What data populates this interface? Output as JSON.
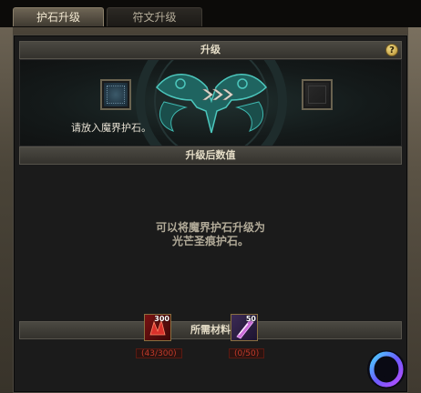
{
  "tabs": [
    {
      "label": "护石升级",
      "active": true
    },
    {
      "label": "符文升级",
      "active": false
    }
  ],
  "upgrade_section": {
    "title": "升级",
    "help_label": "?",
    "slot_hint": "请放入魔界护石。"
  },
  "result_section": {
    "title": "升级后数值",
    "line1": "可以将魔界护石升级为",
    "line2": "光芒圣痕护石。"
  },
  "materials_section": {
    "title": "所需材料",
    "items": [
      {
        "stack": "300",
        "count": "(43/300)",
        "icon": "red-material-icon"
      },
      {
        "stack": "50",
        "count": "(0/50)",
        "icon": "purple-crystal-icon"
      }
    ]
  },
  "colors": {
    "accent_teal": "#3fb8b0",
    "warning_red": "#c23a2a"
  }
}
